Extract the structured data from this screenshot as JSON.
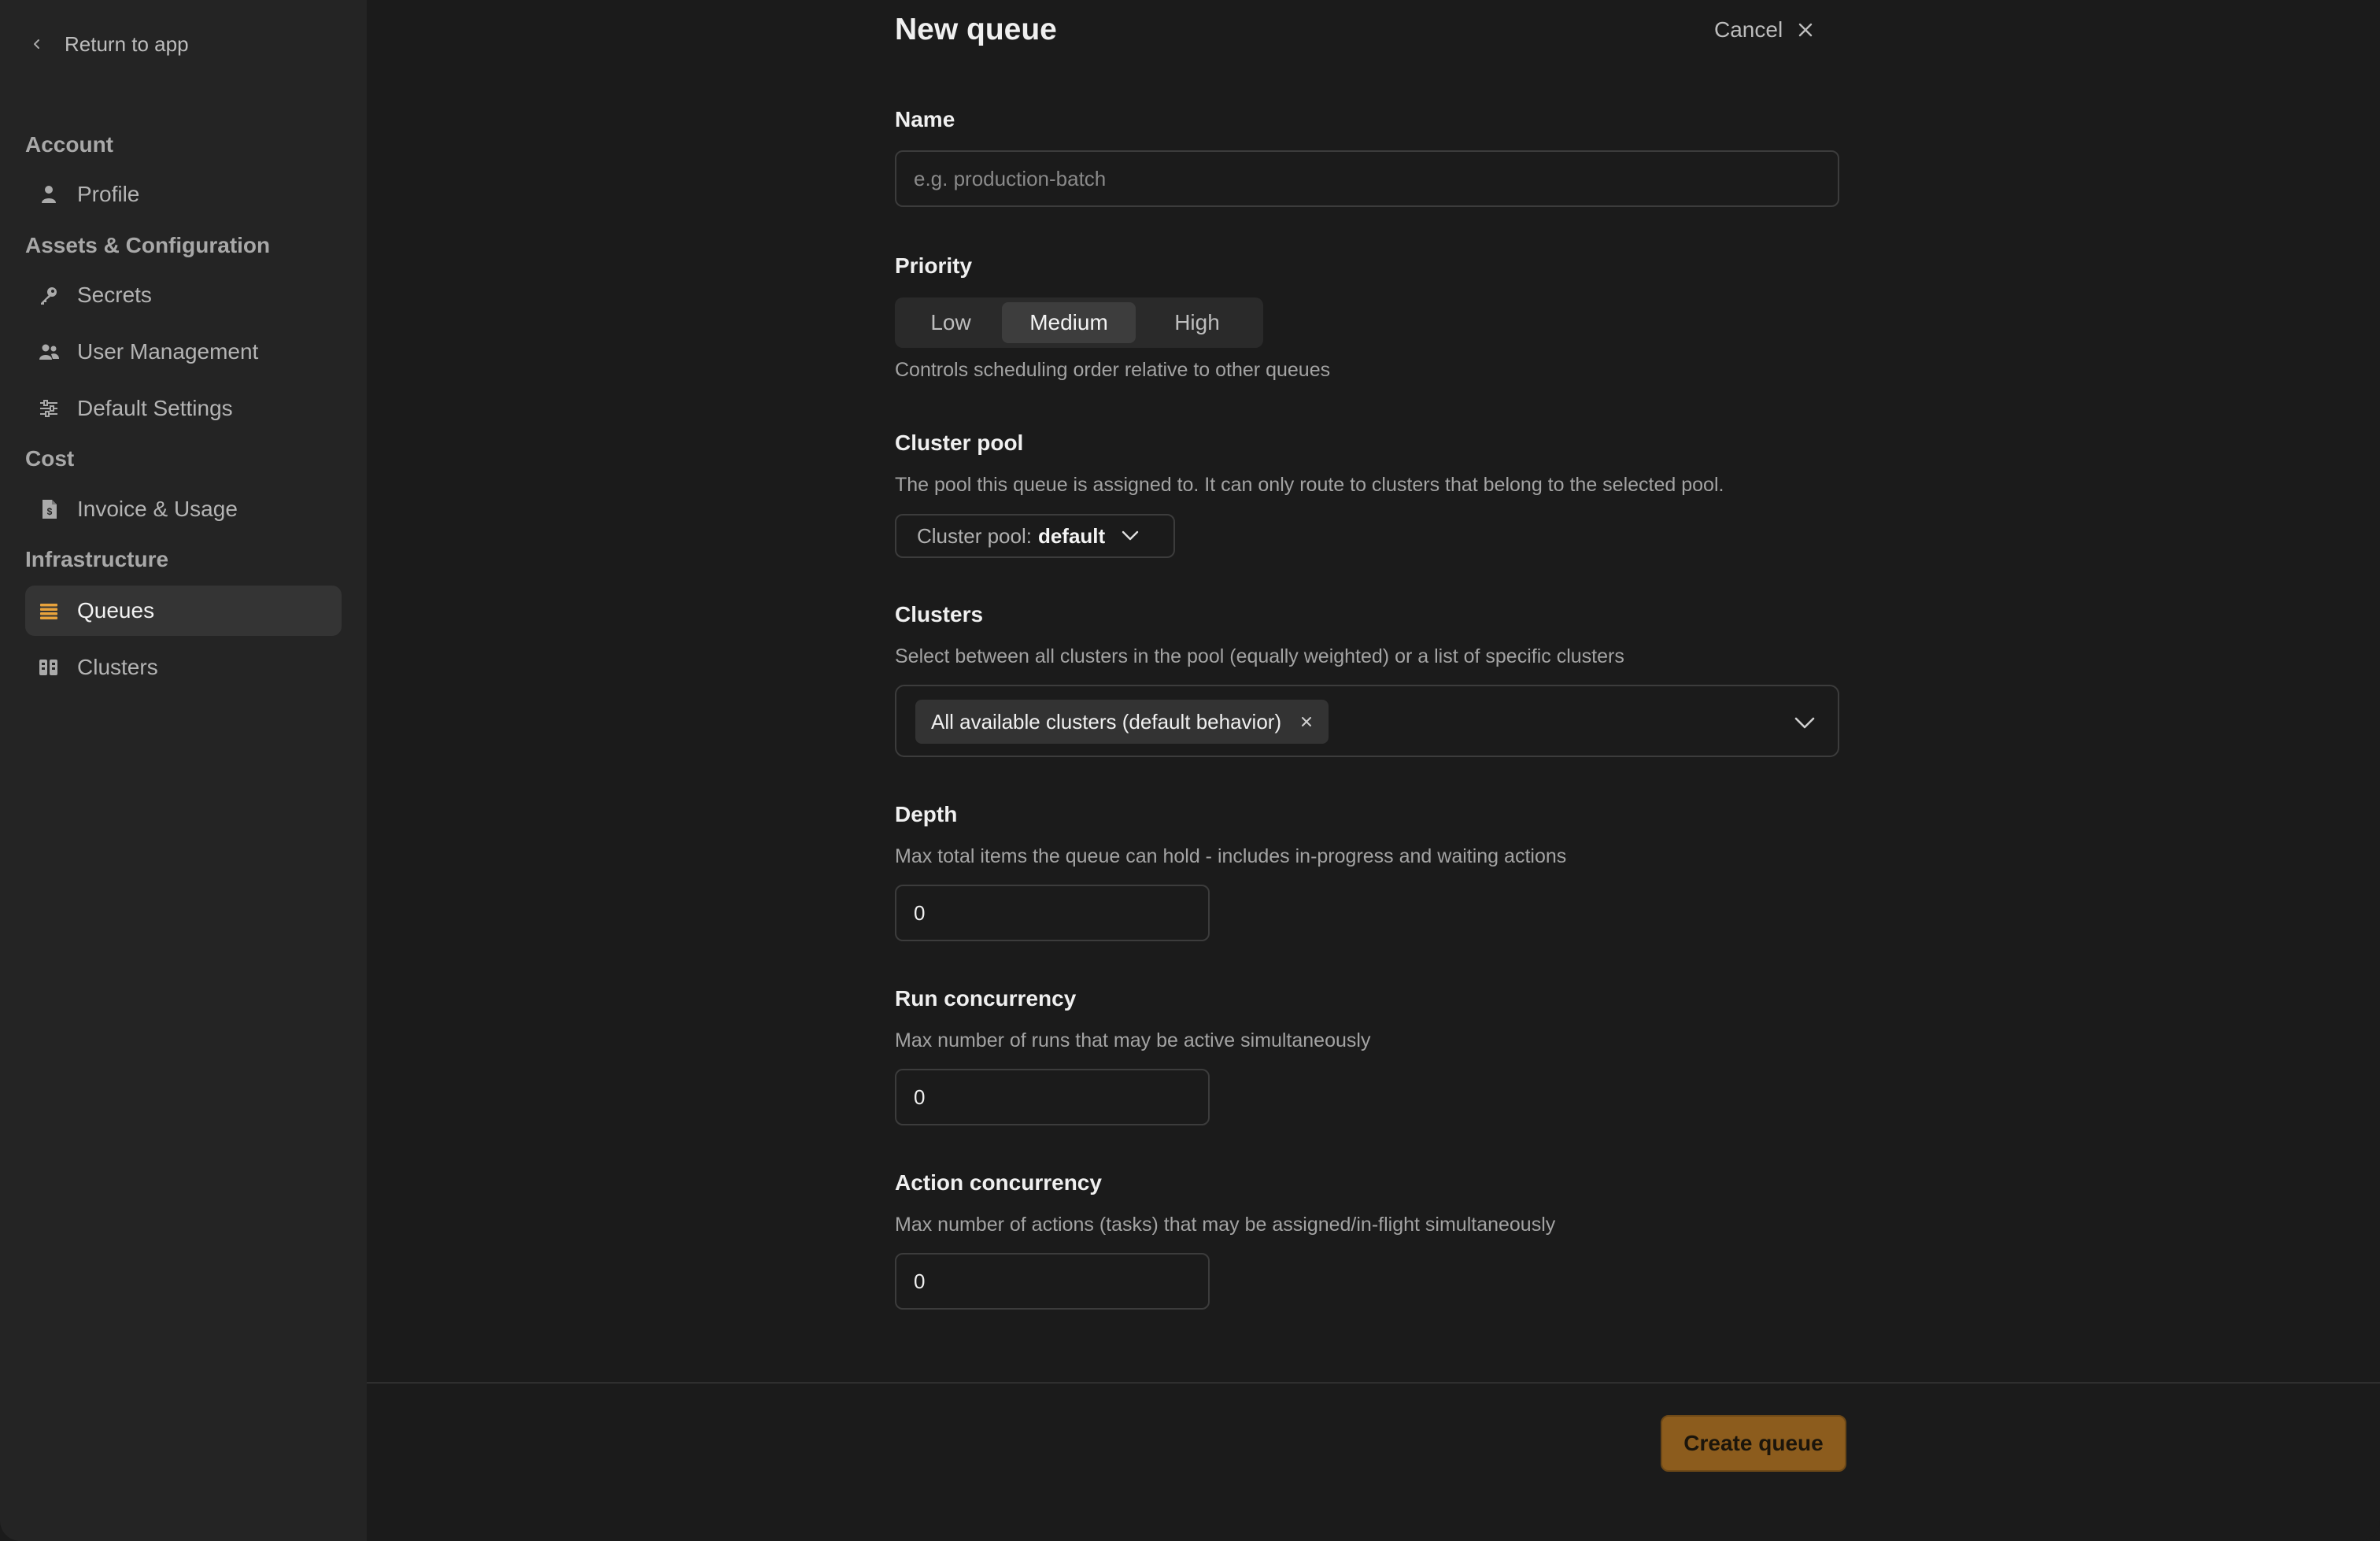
{
  "sidebar": {
    "return_label": "Return to app",
    "sections": {
      "account": "Account",
      "assets": "Assets & Configuration",
      "cost": "Cost",
      "infrastructure": "Infrastructure"
    },
    "items": {
      "profile": {
        "label": "Profile",
        "icon": "user-icon"
      },
      "secrets": {
        "label": "Secrets",
        "icon": "key-icon"
      },
      "user_management": {
        "label": "User Management",
        "icon": "users-icon"
      },
      "default_settings": {
        "label": "Default Settings",
        "icon": "sliders-icon"
      },
      "invoice_usage": {
        "label": "Invoice & Usage",
        "icon": "invoice-icon"
      },
      "queues": {
        "label": "Queues",
        "icon": "queue-icon",
        "active": true
      },
      "clusters": {
        "label": "Clusters",
        "icon": "clusters-icon"
      }
    }
  },
  "header": {
    "title": "New queue",
    "cancel_label": "Cancel"
  },
  "form": {
    "name": {
      "label": "Name",
      "placeholder": "e.g. production-batch",
      "value": ""
    },
    "priority": {
      "label": "Priority",
      "options": [
        "Low",
        "Medium",
        "High"
      ],
      "selected": "Medium",
      "help": "Controls scheduling order relative to other queues"
    },
    "cluster_pool": {
      "label": "Cluster pool",
      "help": "The pool this queue is assigned to. It can only route to clusters that belong to the selected pool.",
      "select_prefix": "Cluster pool:",
      "select_value": "default"
    },
    "clusters": {
      "label": "Clusters",
      "help": "Select between all clusters in the pool (equally weighted) or a list of specific clusters",
      "chip": "All available clusters (default behavior)"
    },
    "depth": {
      "label": "Depth",
      "help": "Max total items the queue can hold - includes in-progress and waiting actions",
      "value": "0"
    },
    "run_concurrency": {
      "label": "Run concurrency",
      "help": "Max number of runs that may be active simultaneously",
      "value": "0"
    },
    "action_concurrency": {
      "label": "Action concurrency",
      "help": "Max number of actions (tasks) that may be assigned/in-flight simultaneously",
      "value": "0"
    }
  },
  "footer": {
    "create_label": "Create queue"
  },
  "colors": {
    "accent": "#b8761f",
    "active_icon": "#e8a33c",
    "background": "#1b1b1b",
    "sidebar": "#242424"
  }
}
